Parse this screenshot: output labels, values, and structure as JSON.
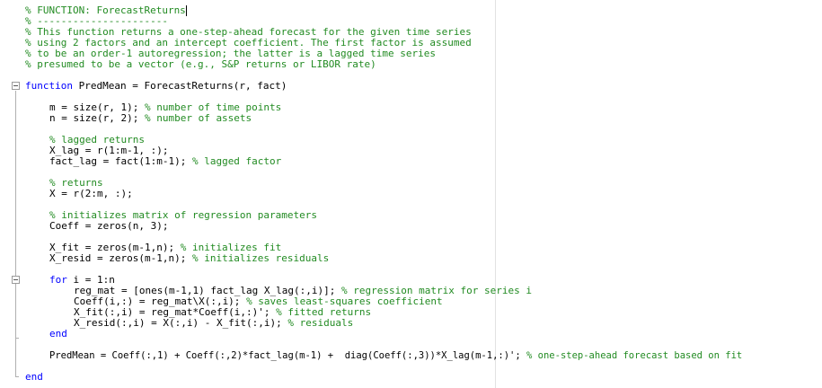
{
  "editor": {
    "lines": {
      "l01": "% FUNCTION: ForecastReturns",
      "l02": "% ----------------------",
      "l03": "% This function returns a one-step-ahead forecast for the given time series",
      "l04": "% using 2 factors and an intercept coefficient. The first factor is assumed",
      "l05": "% to be an order-1 autoregression; the latter is a lagged time series",
      "l06": "% presumed to be a vector (e.g., S&P returns or LIBOR rate)",
      "l07_kw": "function",
      "l07_code": " PredMean = ForecastReturns(r, fact)",
      "l08_code": "m = size(r, 1); ",
      "l08_cm": "% number of time points",
      "l09_code": "n = size(r, 2); ",
      "l09_cm": "% number of assets",
      "l10_cm": "% lagged returns",
      "l11_code": "X_lag = r(1:m-1, :);",
      "l12_code": "fact_lag = fact(1:m-1); ",
      "l12_cm": "% lagged factor",
      "l13_cm": "% returns",
      "l14_code": "X = r(2:m, :);",
      "l15_cm": "% initializes matrix of regression parameters",
      "l16_code": "Coeff = zeros(n, 3);",
      "l17_code": "X_fit = zeros(m-1,n); ",
      "l17_cm": "% initializes fit",
      "l18_code": "X_resid = zeros(m-1,n); ",
      "l18_cm": "% initializes residuals",
      "l19_kw": "for",
      "l19_code": " i = 1:n",
      "l20_code": "reg_mat = [ones(m-1,1) fact_lag X_lag(:,i)]; ",
      "l20_cm": "% regression matrix for series i",
      "l21_code": "Coeff(i,:) = reg_mat\\X(:,i); ",
      "l21_cm": "% saves least-squares coefficient",
      "l22_code": "X_fit(:,i) = reg_mat*Coeff(i,:)'; ",
      "l22_cm": "% fitted returns",
      "l23_code": "X_resid(:,i) = X(:,i) - X_fit(:,i); ",
      "l23_cm": "% residuals",
      "l24_kw": "end",
      "l25_code": "PredMean = Coeff(:,1) + Coeff(:,2)*fact_lag(m-1) +  diag(Coeff(:,3))*X_lag(m-1,:)'; ",
      "l25_cm": "% one-step-ahead forecast based on fit",
      "l26_kw": "end"
    }
  }
}
